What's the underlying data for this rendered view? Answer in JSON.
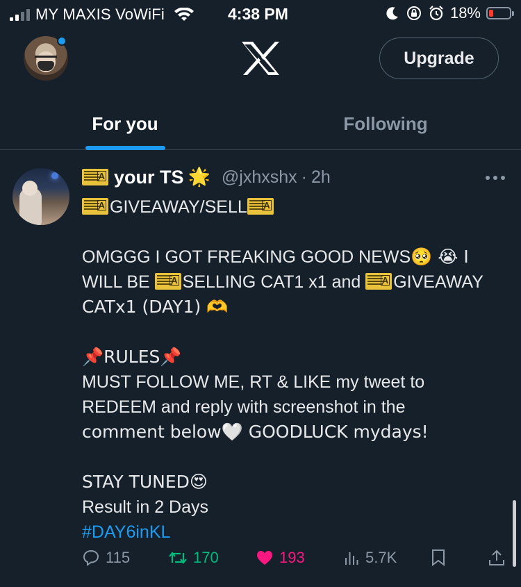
{
  "status_bar": {
    "carrier": "MY MAXIS VoWiFi",
    "time": "4:38 PM",
    "battery": "18%"
  },
  "header": {
    "upgrade_label": "Upgrade"
  },
  "tabs": [
    {
      "label": "For you",
      "active": true
    },
    {
      "label": "Following",
      "active": false
    }
  ],
  "tweet": {
    "name": "your TS",
    "handle": "@jxhxshx",
    "separator": "·",
    "time": "2h",
    "lines": {
      "l1": "GIVEAWAY/SELL",
      "l2a": "OMGGG I GOT FREAKING GOOD NEWS",
      "l2b": "🥺 😭 I",
      "l3a": "WILL BE ",
      "l3b": "SELLING CAT1 x1 and ",
      "l3c": "GIVEAWAY",
      "l4": "CATx1 (DAY1) 🫶",
      "l5a": "📌RULES📌",
      "l6": "MUST FOLLOW ME, RT & LIKE my tweet to",
      "l7": "REDEEM and reply with screenshot in the",
      "l8": "comment below🤍 GOODLUCK mydays!",
      "l9": "STAY TUNED😍",
      "l10": "Result in 2 Days",
      "hashtag": "#DAY6inKL"
    },
    "stats": {
      "replies": "115",
      "retweets": "170",
      "likes": "193",
      "views": "5.7K"
    }
  },
  "colors": {
    "background": "#15202b",
    "accent": "#1d9bf0",
    "retweet": "#00ba7c",
    "like": "#f91880",
    "muted": "#8b98a5"
  }
}
